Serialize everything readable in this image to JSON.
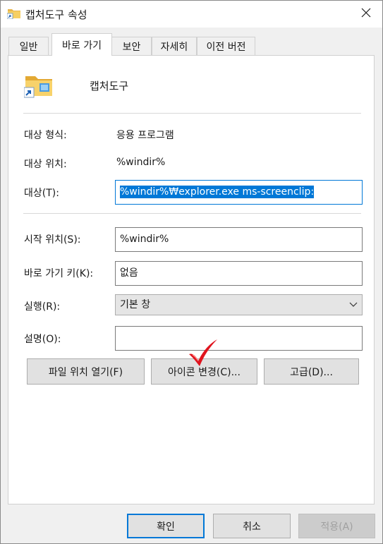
{
  "window": {
    "title": "캡처도구 속성",
    "title_icon": "folder-shortcut-icon",
    "close_icon": "close-icon"
  },
  "tabs": [
    {
      "label": "일반"
    },
    {
      "label": "바로 가기"
    },
    {
      "label": "보안"
    },
    {
      "label": "자세히"
    },
    {
      "label": "이전 버전"
    }
  ],
  "header": {
    "name": "캡처도구",
    "icon": "folder-shortcut-icon"
  },
  "props": {
    "target_type_label": "대상 형식:",
    "target_type_value": "응용 프로그램",
    "target_location_label": "대상 위치:",
    "target_location_value": "%windir%",
    "target_label": "대상(T):",
    "target_value": "%windir%₩explorer.exe ms-screenclip:",
    "start_in_label": "시작 위치(S):",
    "start_in_value": "%windir%",
    "shortcut_key_label": "바로 가기 키(K):",
    "shortcut_key_value": "없음",
    "run_label": "실행(R):",
    "run_value": "기본 창",
    "comment_label": "설명(O):",
    "comment_value": ""
  },
  "actions": {
    "open_location": "파일 위치 열기(F)",
    "change_icon": "아이콘 변경(C)...",
    "advanced": "고급(D)..."
  },
  "footer": {
    "ok": "확인",
    "cancel": "취소",
    "apply": "적용(A)"
  },
  "colors": {
    "accent": "#0078d7",
    "checkmark": "#e0141e"
  }
}
